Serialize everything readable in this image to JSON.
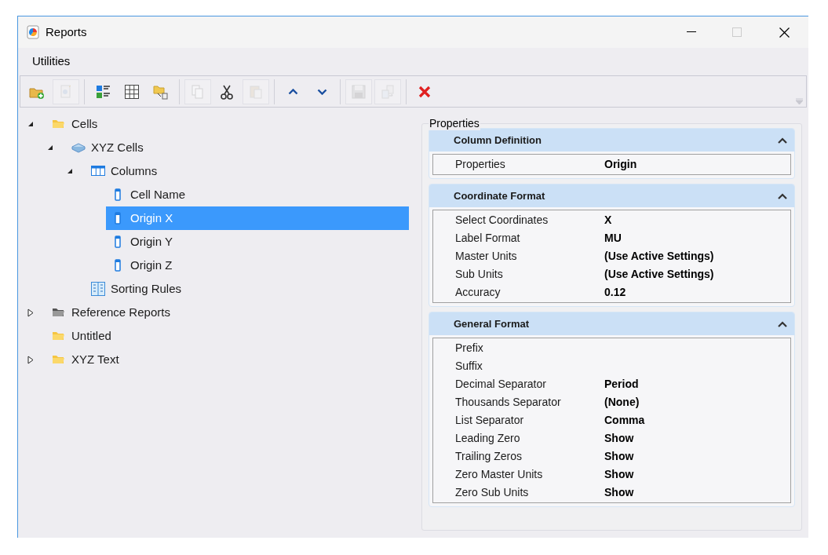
{
  "window": {
    "title": "Reports"
  },
  "menu": [
    "Utilities"
  ],
  "toolbar": [
    {
      "kind": "button",
      "disabled": false
    },
    {
      "kind": "button",
      "disabled": true
    },
    {
      "kind": "separator"
    },
    {
      "kind": "button",
      "disabled": false
    },
    {
      "kind": "button",
      "disabled": false
    },
    {
      "kind": "button",
      "disabled": false
    },
    {
      "kind": "separator"
    },
    {
      "kind": "button",
      "disabled": true
    },
    {
      "kind": "button",
      "disabled": false
    },
    {
      "kind": "button",
      "disabled": true
    },
    {
      "kind": "separator"
    },
    {
      "kind": "button",
      "disabled": false
    },
    {
      "kind": "button",
      "disabled": false
    },
    {
      "kind": "separator"
    },
    {
      "kind": "button",
      "disabled": true
    },
    {
      "kind": "button",
      "disabled": true
    },
    {
      "kind": "separator"
    },
    {
      "kind": "button",
      "disabled": false
    }
  ],
  "tree": [
    {
      "label": "Cells",
      "kind": "folder",
      "expanded": true,
      "selected": false,
      "children": [
        {
          "label": "XYZ Cells",
          "kind": "library",
          "expanded": true,
          "selected": false,
          "children": [
            {
              "label": "Columns",
              "kind": "columns",
              "expanded": true,
              "selected": false,
              "children": [
                {
                  "label": "Cell Name",
                  "kind": "column",
                  "selected": false
                },
                {
                  "label": "Origin X",
                  "kind": "column",
                  "selected": true
                },
                {
                  "label": "Origin Y",
                  "kind": "column",
                  "selected": false
                },
                {
                  "label": "Origin Z",
                  "kind": "column",
                  "selected": false
                }
              ]
            },
            {
              "label": "Sorting Rules",
              "kind": "sorting",
              "selected": false
            }
          ]
        }
      ]
    },
    {
      "label": "Reference Reports",
      "kind": "reference-folder",
      "expanded": false,
      "selected": false
    },
    {
      "label": "Untitled",
      "kind": "folder",
      "selected": false
    },
    {
      "label": "XYZ Text",
      "kind": "folder",
      "expanded": false,
      "selected": false
    }
  ],
  "properties": {
    "title": "Properties",
    "sections": [
      {
        "title": "Column Definition",
        "expanded": true,
        "rows": [
          {
            "label": "Properties",
            "value": "Origin"
          }
        ]
      },
      {
        "title": "Coordinate Format",
        "expanded": true,
        "rows": [
          {
            "label": "Select Coordinates",
            "value": "X"
          },
          {
            "label": "Label Format",
            "value": "MU"
          },
          {
            "label": "Master Units",
            "value": "(Use Active Settings)"
          },
          {
            "label": "Sub Units",
            "value": "(Use Active Settings)"
          },
          {
            "label": "Accuracy",
            "value": "0.12"
          }
        ]
      },
      {
        "title": "General Format",
        "expanded": true,
        "rows": [
          {
            "label": "Prefix"
          },
          {
            "label": "Suffix"
          },
          {
            "label": "Decimal Separator",
            "value": "Period"
          },
          {
            "label": "Thousands Separator",
            "value": "(None)"
          },
          {
            "label": "List Separator",
            "value": "Comma"
          },
          {
            "label": "Leading Zero",
            "value": "Show"
          },
          {
            "label": "Trailing Zeros",
            "value": "Show"
          },
          {
            "label": "Zero Master Units",
            "value": "Show"
          },
          {
            "label": "Zero Sub Units",
            "value": "Show"
          }
        ]
      }
    ]
  }
}
